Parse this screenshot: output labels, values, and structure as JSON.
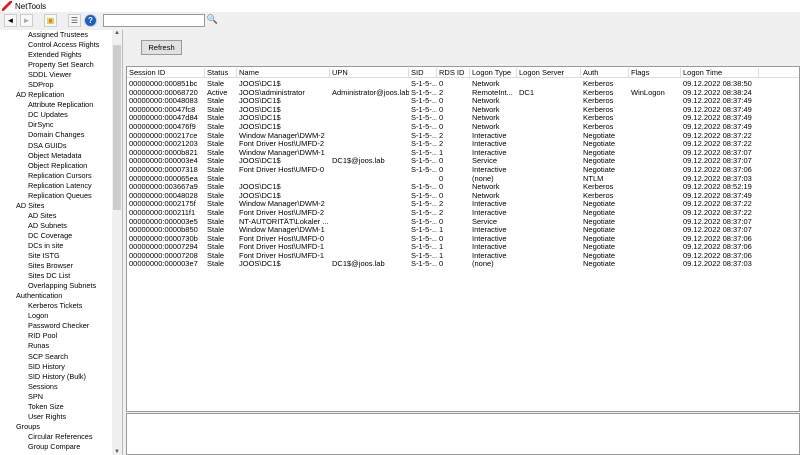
{
  "app": {
    "title": "NetTools"
  },
  "toolbar": {
    "back": "◄",
    "forward": "►",
    "search_value": "",
    "search_icon": "search-icon"
  },
  "sidebar": {
    "items": [
      {
        "label": "Assigned Trustees",
        "level": 1
      },
      {
        "label": "Control Access Rights",
        "level": 1
      },
      {
        "label": "Extended Rights",
        "level": 1
      },
      {
        "label": "Property Set Search",
        "level": 1
      },
      {
        "label": "SDDL Viewer",
        "level": 1
      },
      {
        "label": "SDProp",
        "level": 1
      },
      {
        "label": "AD Replication",
        "level": 0
      },
      {
        "label": "Attribute Replication",
        "level": 1
      },
      {
        "label": "DC Updates",
        "level": 1
      },
      {
        "label": "DirSync",
        "level": 1
      },
      {
        "label": "Domain Changes",
        "level": 1
      },
      {
        "label": "DSA GUIDs",
        "level": 1
      },
      {
        "label": "Object Metadata",
        "level": 1
      },
      {
        "label": "Object Replication",
        "level": 1
      },
      {
        "label": "Replication Cursors",
        "level": 1
      },
      {
        "label": "Replication Latency",
        "level": 1
      },
      {
        "label": "Replication Queues",
        "level": 1
      },
      {
        "label": "AD Sites",
        "level": 0
      },
      {
        "label": "AD Sites",
        "level": 1
      },
      {
        "label": "AD Subnets",
        "level": 1
      },
      {
        "label": "DC Coverage",
        "level": 1
      },
      {
        "label": "DCs in site",
        "level": 1
      },
      {
        "label": "Site ISTG",
        "level": 1
      },
      {
        "label": "Sites Browser",
        "level": 1
      },
      {
        "label": "Sites DC List",
        "level": 1
      },
      {
        "label": "Overlapping Subnets",
        "level": 1
      },
      {
        "label": "Authentication",
        "level": 0
      },
      {
        "label": "Kerberos Tickets",
        "level": 1
      },
      {
        "label": "Logon",
        "level": 1
      },
      {
        "label": "Password Checker",
        "level": 1
      },
      {
        "label": "RID Pool",
        "level": 1
      },
      {
        "label": "Runas",
        "level": 1
      },
      {
        "label": "SCP Search",
        "level": 1
      },
      {
        "label": "SID History",
        "level": 1
      },
      {
        "label": "SID History (Bulk)",
        "level": 1
      },
      {
        "label": "Sessions",
        "level": 1
      },
      {
        "label": "SPN",
        "level": 1
      },
      {
        "label": "Token Size",
        "level": 1
      },
      {
        "label": "User Rights",
        "level": 1
      },
      {
        "label": "Groups",
        "level": 0
      },
      {
        "label": "Circular References",
        "level": 1
      },
      {
        "label": "Group Compare",
        "level": 1
      }
    ]
  },
  "main": {
    "refresh_label": "Refresh",
    "columns": [
      "Session ID",
      "Status",
      "Name",
      "UPN",
      "SID",
      "RDS ID",
      "Logon Type",
      "Logon Server",
      "Auth",
      "Flags",
      "Logon Time"
    ],
    "rows": [
      [
        "00000000:000851bc",
        "Stale",
        "JOOS\\DC1$",
        "",
        "S-1-5-...",
        "0",
        "Network",
        "",
        "Kerberos",
        "",
        "09.12.2022 08:38:50"
      ],
      [
        "00000000:00068720",
        "Active",
        "JOOS\\administrator",
        "Administrator@joos.lab",
        "S-1-5-...",
        "2",
        "RemoteInt...",
        "DC1",
        "Kerberos",
        "WinLogon",
        "09.12.2022 08:38:24"
      ],
      [
        "00000000:00048083",
        "Stale",
        "JOOS\\DC1$",
        "",
        "S-1-5-...",
        "0",
        "Network",
        "",
        "Kerberos",
        "",
        "09.12.2022 08:37:49"
      ],
      [
        "00000000:00047fc8",
        "Stale",
        "JOOS\\DC1$",
        "",
        "S-1-5-...",
        "0",
        "Network",
        "",
        "Kerberos",
        "",
        "09.12.2022 08:37:49"
      ],
      [
        "00000000:00047d84",
        "Stale",
        "JOOS\\DC1$",
        "",
        "S-1-5-...",
        "0",
        "Network",
        "",
        "Kerberos",
        "",
        "09.12.2022 08:37:49"
      ],
      [
        "00000000:000476f9",
        "Stale",
        "JOOS\\DC1$",
        "",
        "S-1-5-...",
        "0",
        "Network",
        "",
        "Kerberos",
        "",
        "09.12.2022 08:37:49"
      ],
      [
        "00000000:000217ce",
        "Stale",
        "Window Manager\\DWM-2",
        "",
        "S-1-5-...",
        "2",
        "Interactive",
        "",
        "Negotiate",
        "",
        "09.12.2022 08:37:22"
      ],
      [
        "00000000:00021203",
        "Stale",
        "Font Driver Host\\UMFD-2",
        "",
        "S-1-5-...",
        "2",
        "Interactive",
        "",
        "Negotiate",
        "",
        "09.12.2022 08:37:22"
      ],
      [
        "00000000:0000b821",
        "Stale",
        "Window Manager\\DWM-1",
        "",
        "S-1-5-...",
        "1",
        "Interactive",
        "",
        "Negotiate",
        "",
        "09.12.2022 08:37:07"
      ],
      [
        "00000000:000003e4",
        "Stale",
        "JOOS\\DC1$",
        "DC1$@joos.lab",
        "S-1-5-...",
        "0",
        "Service",
        "",
        "Negotiate",
        "",
        "09.12.2022 08:37:07"
      ],
      [
        "00000000:00007318",
        "Stale",
        "Font Driver Host\\UMFD-0",
        "",
        "S-1-5-...",
        "0",
        "Interactive",
        "",
        "Negotiate",
        "",
        "09.12.2022 08:37:06"
      ],
      [
        "00000000:000065ea",
        "Stale",
        "",
        "",
        "",
        "0",
        "(none)",
        "",
        "NTLM",
        "",
        "09.12.2022 08:37:03"
      ],
      [
        "00000000:003667a9",
        "Stale",
        "JOOS\\DC1$",
        "",
        "S-1-5-...",
        "0",
        "Network",
        "",
        "Kerberos",
        "",
        "09.12.2022 08:52:19"
      ],
      [
        "00000000:00048028",
        "Stale",
        "JOOS\\DC1$",
        "",
        "S-1-5-...",
        "0",
        "Network",
        "",
        "Kerberos",
        "",
        "09.12.2022 08:37:49"
      ],
      [
        "00000000:0002175f",
        "Stale",
        "Window Manager\\DWM-2",
        "",
        "S-1-5-...",
        "2",
        "Interactive",
        "",
        "Negotiate",
        "",
        "09.12.2022 08:37:22"
      ],
      [
        "00000000:000211f1",
        "Stale",
        "Font Driver Host\\UMFD-2",
        "",
        "S-1-5-...",
        "2",
        "Interactive",
        "",
        "Negotiate",
        "",
        "09.12.2022 08:37:22"
      ],
      [
        "00000000:000003e5",
        "Stale",
        "NT-AUTORITÄT\\Lokaler ...",
        "",
        "S-1-5-...",
        "0",
        "Service",
        "",
        "Negotiate",
        "",
        "09.12.2022 08:37:07"
      ],
      [
        "00000000:0000b850",
        "Stale",
        "Window Manager\\DWM-1",
        "",
        "S-1-5-...",
        "1",
        "Interactive",
        "",
        "Negotiate",
        "",
        "09.12.2022 08:37:07"
      ],
      [
        "00000000:0000730b",
        "Stale",
        "Font Driver Host\\UMFD-0",
        "",
        "S-1-5-...",
        "0",
        "Interactive",
        "",
        "Negotiate",
        "",
        "09.12.2022 08:37:06"
      ],
      [
        "00000000:00007294",
        "Stale",
        "Font Driver Host\\UMFD-1",
        "",
        "S-1-5-...",
        "1",
        "Interactive",
        "",
        "Negotiate",
        "",
        "09.12.2022 08:37:06"
      ],
      [
        "00000000:00007208",
        "Stale",
        "Font Driver Host\\UMFD-1",
        "",
        "S-1-5-...",
        "1",
        "Interactive",
        "",
        "Negotiate",
        "",
        "09.12.2022 08:37:06"
      ],
      [
        "00000000:000003e7",
        "Stale",
        "JOOS\\DC1$",
        "DC1$@joos.lab",
        "S-1-5-...",
        "0",
        "(none)",
        "",
        "Negotiate",
        "",
        "09.12.2022 08:37:03"
      ]
    ]
  }
}
